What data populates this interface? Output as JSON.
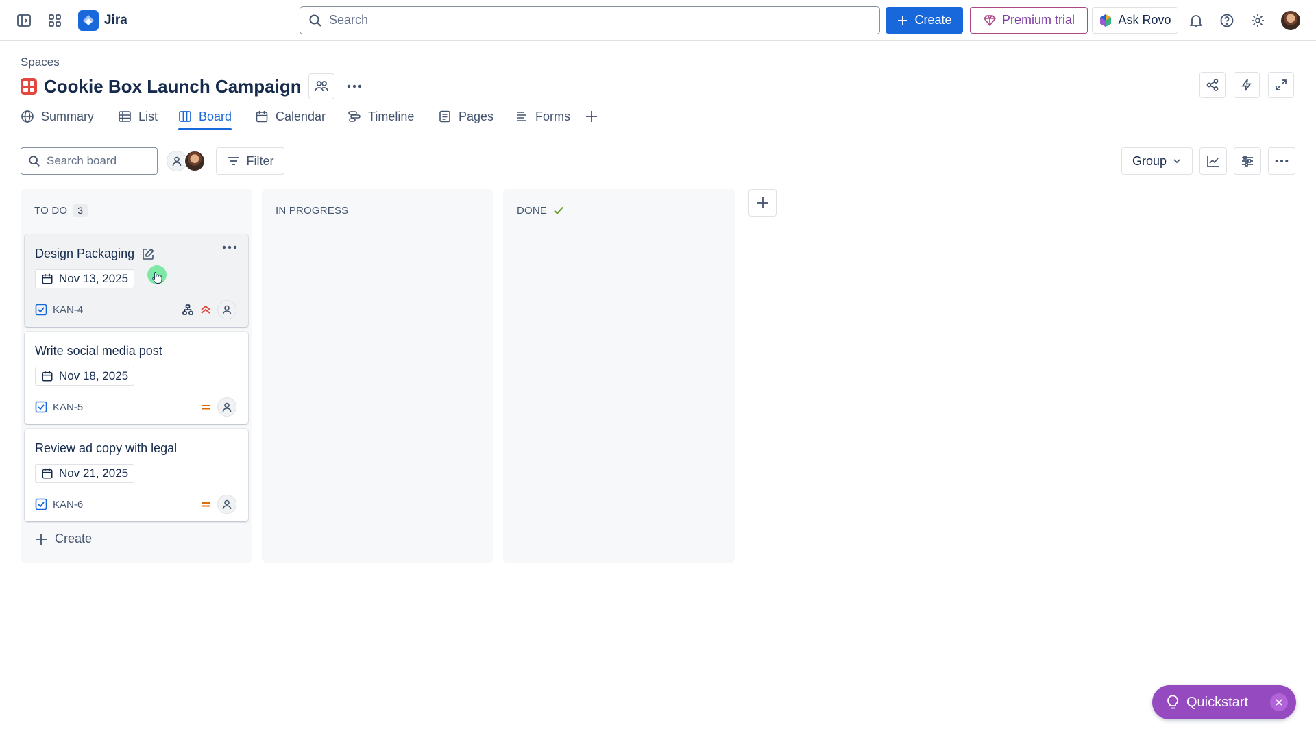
{
  "app": {
    "name": "Jira"
  },
  "topbar": {
    "search_placeholder": "Search",
    "create_label": "Create",
    "premium_label": "Premium trial",
    "rovo_label": "Ask Rovo"
  },
  "space": {
    "breadcrumb": "Spaces",
    "title": "Cookie Box Launch Campaign"
  },
  "tabs": [
    {
      "label": "Summary",
      "icon": "globe-icon"
    },
    {
      "label": "List",
      "icon": "list-icon"
    },
    {
      "label": "Board",
      "icon": "board-icon",
      "active": true
    },
    {
      "label": "Calendar",
      "icon": "calendar-icon"
    },
    {
      "label": "Timeline",
      "icon": "timeline-icon"
    },
    {
      "label": "Pages",
      "icon": "pages-icon"
    },
    {
      "label": "Forms",
      "icon": "forms-icon"
    }
  ],
  "board": {
    "search_placeholder": "Search board",
    "filter_label": "Filter",
    "group_label": "Group",
    "columns": [
      {
        "name": "TO DO",
        "count": "3",
        "cards": [
          {
            "title": "Design Packaging",
            "due": "Nov 13, 2025",
            "key": "KAN-4",
            "priority": "high"
          },
          {
            "title": "Write social media post",
            "due": "Nov 18, 2025",
            "key": "KAN-5",
            "priority": "medium"
          },
          {
            "title": "Review ad copy with legal",
            "due": "Nov 21, 2025",
            "key": "KAN-6",
            "priority": "medium"
          }
        ],
        "create_label": "Create"
      },
      {
        "name": "IN PROGRESS"
      },
      {
        "name": "DONE"
      }
    ]
  },
  "quickstart": {
    "label": "Quickstart"
  },
  "colors": {
    "brand_blue": "#1868db",
    "premium_purple": "#803fa5",
    "quickstart_purple": "#964ac0",
    "space_icon_red": "#e2483d",
    "priority_high": "#e2483d",
    "priority_medium": "#e06c00",
    "done_check": "#6a9a23"
  }
}
